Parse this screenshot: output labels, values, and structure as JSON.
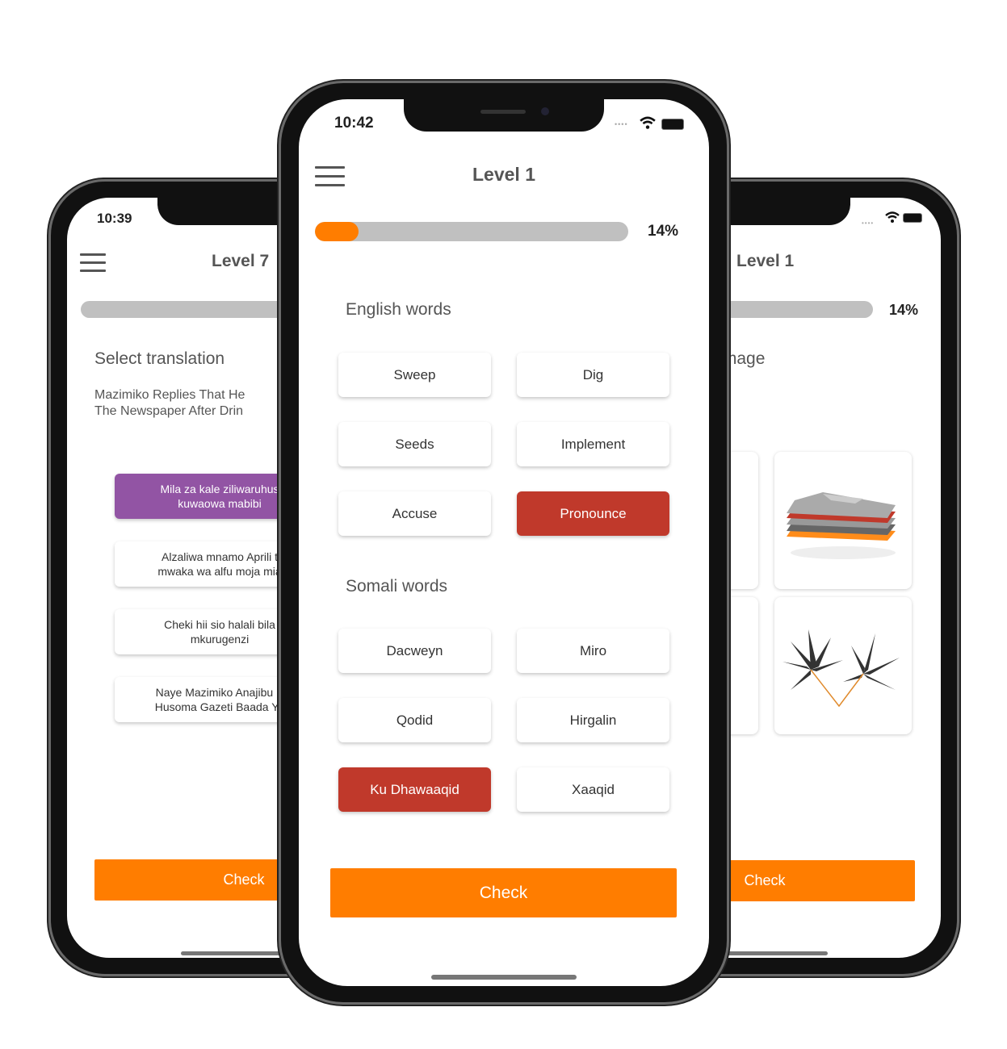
{
  "left_phone": {
    "time": "10:39",
    "title": "Level 7",
    "prompt": "Select translation",
    "sentence_line1": "Mazimiko Replies That He",
    "sentence_line2": "The Newspaper After Drin",
    "options": [
      {
        "line1": "Mila za kale ziliwaruhus",
        "line2": "kuwaowa mabibi",
        "selected": true
      },
      {
        "line1": "Alzaliwa mnamo Aprili t",
        "line2": "mwaka wa alfu moja mia",
        "selected": false
      },
      {
        "line1": "Cheki hii sio halali bila",
        "line2": "mkurugenzi",
        "selected": false
      },
      {
        "line1": "Naye Mazimiko Anajibu K",
        "line2": "Husoma Gazeti Baada Ya",
        "selected": false
      }
    ],
    "check_label": "Check",
    "colors": {
      "selected": "#9254a4"
    }
  },
  "center_phone": {
    "time": "10:42",
    "title": "Level 1",
    "progress_percent": 14,
    "progress_label": "14%",
    "english_heading": "English words",
    "english_words": [
      {
        "label": "Sweep",
        "selected": false
      },
      {
        "label": "Dig",
        "selected": false
      },
      {
        "label": "Seeds",
        "selected": false
      },
      {
        "label": "Implement",
        "selected": false
      },
      {
        "label": "Accuse",
        "selected": false
      },
      {
        "label": "Pronounce",
        "selected": true
      }
    ],
    "somali_heading": "Somali words",
    "somali_words": [
      {
        "label": "Dacweyn",
        "selected": false
      },
      {
        "label": "Miro",
        "selected": false
      },
      {
        "label": "Qodid",
        "selected": false
      },
      {
        "label": "Hirgalin",
        "selected": false
      },
      {
        "label": "Ku Dhawaaqid",
        "selected": true
      },
      {
        "label": "Xaaqid",
        "selected": false
      }
    ],
    "check_label": "Check",
    "icons": [
      "menu-icon",
      "signal-icon",
      "wifi-icon",
      "battery-icon"
    ],
    "colors": {
      "accent": "#ff7d00",
      "selected": "#c0392b",
      "track": "#c0c0c0"
    }
  },
  "right_phone": {
    "title": "Level 1",
    "progress_label": "14%",
    "prompt": "Select image",
    "images": [
      "clothes-stack-image",
      "leaves-image"
    ],
    "check_label": "Check"
  }
}
